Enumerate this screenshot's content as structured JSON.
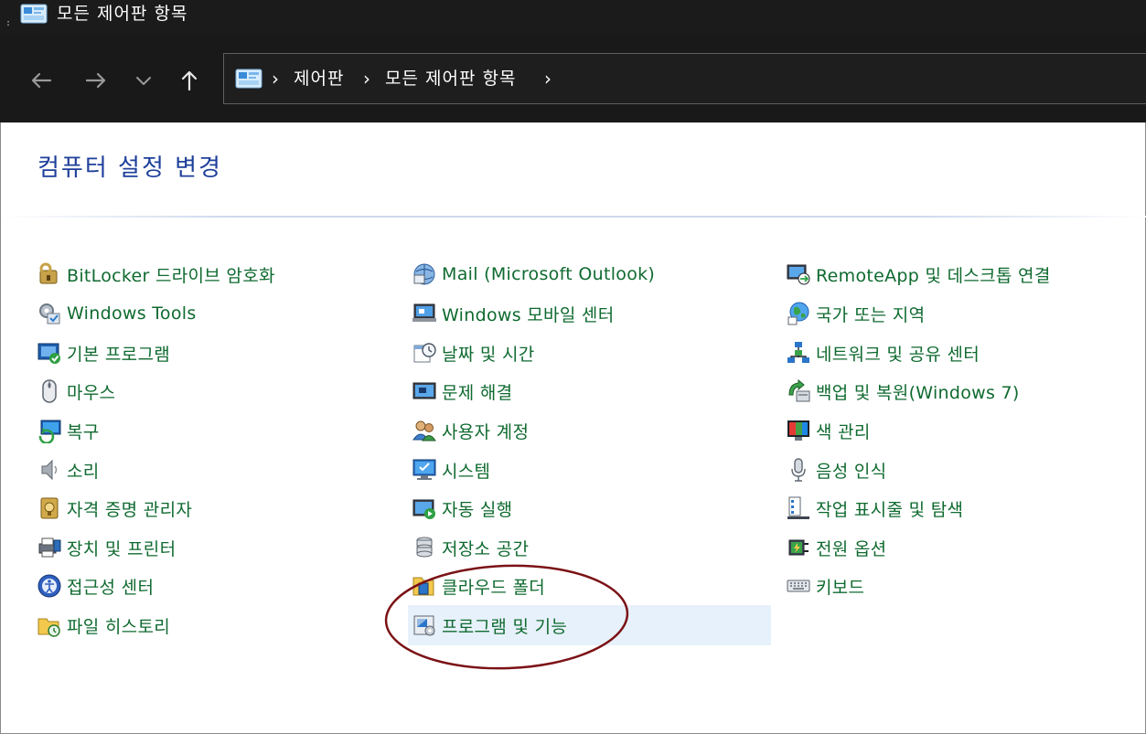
{
  "window": {
    "title": "모든 제어판 항목"
  },
  "nav": {
    "back_icon": "arrow-left-icon",
    "forward_icon": "arrow-right-icon",
    "recent_icon": "chevron-down-icon",
    "up_icon": "arrow-up-icon"
  },
  "breadcrumb": {
    "items": [
      "제어판",
      "모든 제어판 항목"
    ],
    "separator": "›"
  },
  "main": {
    "heading": "컴퓨터 설정 변경",
    "columns": [
      [
        {
          "label": "BitLocker 드라이브 암호화",
          "icon": "bitlocker-key-icon"
        },
        {
          "label": "Windows Tools",
          "icon": "windows-tools-icon"
        },
        {
          "label": "기본 프로그램",
          "icon": "default-programs-icon"
        },
        {
          "label": "마우스",
          "icon": "mouse-icon"
        },
        {
          "label": "복구",
          "icon": "recovery-icon"
        },
        {
          "label": "소리",
          "icon": "speaker-icon"
        },
        {
          "label": "자격 증명 관리자",
          "icon": "credential-manager-icon"
        },
        {
          "label": "장치 및 프린터",
          "icon": "printer-icon"
        },
        {
          "label": "접근성 센터",
          "icon": "accessibility-icon"
        },
        {
          "label": "파일 히스토리",
          "icon": "file-history-icon"
        }
      ],
      [
        {
          "label": "Mail (Microsoft Outlook)",
          "icon": "mail-icon"
        },
        {
          "label": "Windows 모바일 센터",
          "icon": "mobility-center-icon"
        },
        {
          "label": "날짜 및 시간",
          "icon": "calendar-clock-icon"
        },
        {
          "label": "문제 해결",
          "icon": "troubleshooting-icon"
        },
        {
          "label": "사용자 계정",
          "icon": "user-accounts-icon"
        },
        {
          "label": "시스템",
          "icon": "system-monitor-icon"
        },
        {
          "label": "자동 실행",
          "icon": "autoplay-icon"
        },
        {
          "label": "저장소 공간",
          "icon": "storage-spaces-icon"
        },
        {
          "label": "클라우드 폴더",
          "icon": "cloud-folder-icon"
        },
        {
          "label": "프로그램 및 기능",
          "icon": "programs-features-icon",
          "selected": true
        }
      ],
      [
        {
          "label": "RemoteApp 및 데스크톱 연결",
          "icon": "remoteapp-icon"
        },
        {
          "label": "국가 또는 지역",
          "icon": "globe-region-icon"
        },
        {
          "label": "네트워크 및 공유 센터",
          "icon": "network-icon"
        },
        {
          "label": "백업 및 복원(Windows 7)",
          "icon": "backup-restore-icon"
        },
        {
          "label": "색 관리",
          "icon": "color-management-icon"
        },
        {
          "label": "음성 인식",
          "icon": "microphone-icon"
        },
        {
          "label": "작업 표시줄 및 탐색",
          "icon": "taskbar-icon"
        },
        {
          "label": "전원 옵션",
          "icon": "power-options-icon"
        },
        {
          "label": "키보드",
          "icon": "keyboard-icon"
        }
      ]
    ]
  },
  "colors": {
    "title_bg": "#1b1b1b",
    "link_green": "#0f6a2f",
    "heading_blue": "#1e3f9a",
    "selected_bg": "#e7f1fb",
    "annotation": "#7b1216"
  }
}
